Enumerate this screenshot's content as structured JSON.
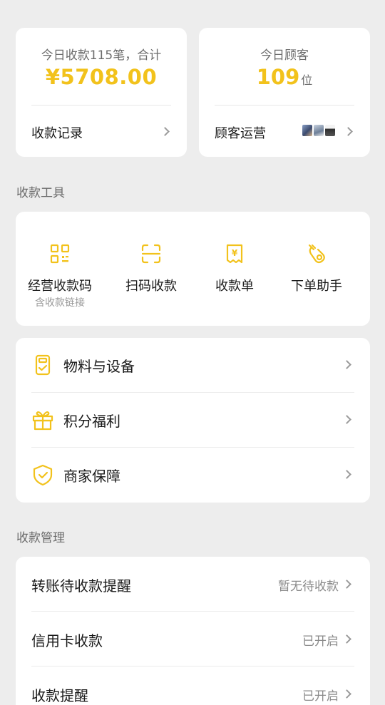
{
  "summary": {
    "payments": {
      "caption": "今日收款115笔，合计",
      "amount": "¥5708.00",
      "link_label": "收款记录"
    },
    "customers": {
      "caption": "今日顾客",
      "count": "109",
      "unit": "位",
      "link_label": "顾客运营"
    }
  },
  "tools_section": {
    "title": "收款工具",
    "items": [
      {
        "label": "经营收款码",
        "sub": "含收款链接",
        "icon": "qr-code-icon"
      },
      {
        "label": "扫码收款",
        "sub": "",
        "icon": "scan-icon"
      },
      {
        "label": "收款单",
        "sub": "",
        "icon": "receipt-icon"
      },
      {
        "label": "下单助手",
        "sub": "",
        "icon": "order-assistant-icon"
      }
    ]
  },
  "menu": {
    "items": [
      {
        "label": "物料与设备",
        "icon": "device-icon"
      },
      {
        "label": "积分福利",
        "icon": "gift-icon"
      },
      {
        "label": "商家保障",
        "icon": "shield-icon"
      }
    ]
  },
  "management_section": {
    "title": "收款管理",
    "items": [
      {
        "label": "转账待收款提醒",
        "status": "暂无待收款"
      },
      {
        "label": "信用卡收款",
        "status": "已开启"
      },
      {
        "label": "收款提醒",
        "status": "已开启"
      }
    ]
  },
  "colors": {
    "accent": "#f2c21c",
    "background": "#ededed",
    "card": "#ffffff",
    "secondary_text": "#6b6b6b"
  }
}
